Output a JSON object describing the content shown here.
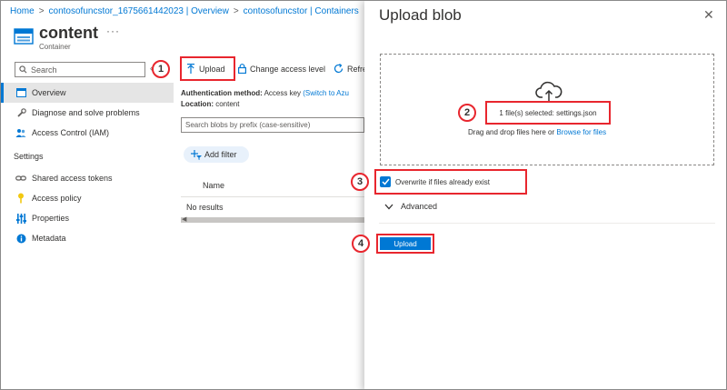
{
  "breadcrumb": {
    "items": [
      "Home",
      "contosofuncstor_1675661442023 | Overview",
      "contosofuncstor | Containers"
    ],
    "separator": ">"
  },
  "header": {
    "title": "content",
    "subtitle": "Container",
    "more": "···"
  },
  "sidebar": {
    "search_placeholder": "Search",
    "collapse": "«",
    "items": [
      {
        "label": "Overview",
        "icon": "overview-icon",
        "active": true
      },
      {
        "label": "Diagnose and solve problems",
        "icon": "wrench-icon"
      },
      {
        "label": "Access Control (IAM)",
        "icon": "people-icon"
      }
    ],
    "settings_heading": "Settings",
    "settings_items": [
      {
        "label": "Shared access tokens",
        "icon": "link-icon"
      },
      {
        "label": "Access policy",
        "icon": "key-icon"
      },
      {
        "label": "Properties",
        "icon": "sliders-icon"
      },
      {
        "label": "Metadata",
        "icon": "info-icon"
      }
    ]
  },
  "toolbar": {
    "upload_label": "Upload",
    "change_access_label": "Change access level",
    "refresh_label": "Refre"
  },
  "main": {
    "auth_label": "Authentication method:",
    "auth_value": "Access key",
    "auth_link": "(Switch to Azu",
    "location_label": "Location:",
    "location_value": "content",
    "search_placeholder": "Search blobs by prefix (case-sensitive)",
    "add_filter_label": "Add filter",
    "column_name": "Name",
    "no_results": "No results"
  },
  "panel": {
    "title": "Upload blob",
    "close": "✕",
    "files_selected": "1 file(s) selected: settings.json",
    "drag_text": "Drag and drop files here or",
    "browse_link": "Browse for files",
    "overwrite_label": "Overwrite if files already exist",
    "overwrite_checked": true,
    "advanced_label": "Advanced",
    "upload_button": "Upload"
  },
  "callouts": [
    "1",
    "2",
    "3",
    "4"
  ],
  "colors": {
    "accent": "#0078d4",
    "highlight": "#e8262e"
  }
}
